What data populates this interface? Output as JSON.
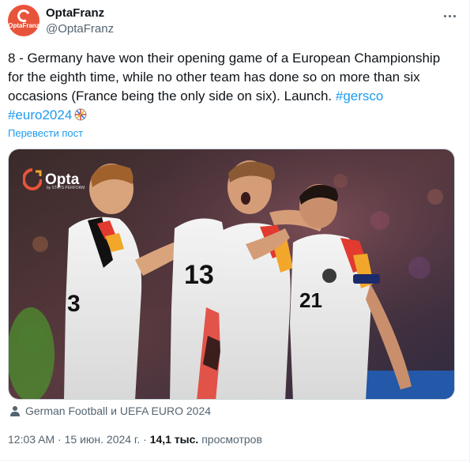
{
  "author": {
    "display_name": "OptaFranz",
    "handle": "@OptaFranz",
    "avatar_text": "OptaFranz",
    "avatar_color": "#e8543a"
  },
  "tweet": {
    "lines": [
      "8 - Germany have won their opening game of a European Championship",
      "for the eighth time, while no other team has done so on more than six",
      "occasions (France being the only side on six). Launch."
    ],
    "hashtag_1": "#gersco",
    "hashtag_2": "#euro2024"
  },
  "translate_label": "Перевести пост",
  "media": {
    "watermark_brand": "Opta",
    "watermark_sub": "by STATS PERFORM",
    "jersey_numbers": [
      "3",
      "13",
      "21"
    ]
  },
  "tagged_label": "German Football и UEFA EURO 2024",
  "meta": {
    "time": "12:03 AM",
    "separator_1": "·",
    "date": "15 июн. 2024 г.",
    "separator_2": "·",
    "views_count": "14,1 тыс.",
    "views_label": "просмотров"
  },
  "colors": {
    "link": "#1d9bf0",
    "secondary_text": "#536471",
    "primary_text": "#0f1419"
  }
}
